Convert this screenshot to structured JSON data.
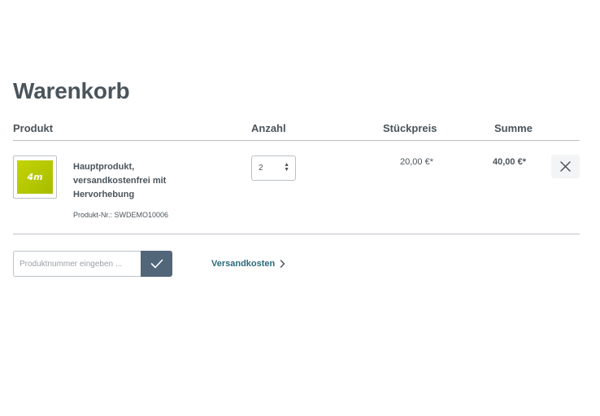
{
  "page": {
    "title": "Warenkorb"
  },
  "cart": {
    "headers": {
      "product": "Produkt",
      "quantity": "Anzahl",
      "unit_price": "Stückpreis",
      "total": "Summe"
    },
    "items": [
      {
        "image_label": "4m",
        "name": "Hauptprodukt, versandkostenfrei mit Hervorhebung",
        "number": "Produkt-Nr.: SWDEMO10006",
        "quantity": "2",
        "unit_price": "20,00 €*",
        "total": "40,00 €*"
      }
    ]
  },
  "promo": {
    "placeholder": "Produktnummer eingeben ..."
  },
  "shipping": {
    "label": "Versandkosten"
  },
  "colors": {
    "text": "#4a545b",
    "border": "#bcc1c7",
    "submit_button": "#52667a",
    "link": "#2b6b7a",
    "product_image": "#c3d400"
  },
  "icons": {
    "remove": "close-icon",
    "submit": "checkmark-icon",
    "shipping": "chevron-right-icon",
    "quantity": "sort-arrows-icon"
  }
}
